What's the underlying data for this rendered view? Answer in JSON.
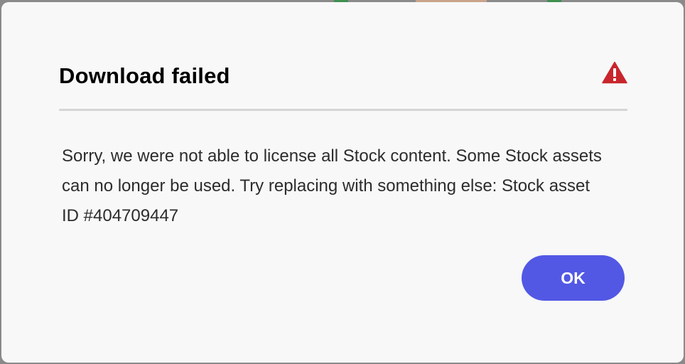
{
  "dialog": {
    "title": "Download failed",
    "message": "Sorry, we were not able to license all Stock content. Some Stock assets can no longer be used. Try replacing with something else: Stock asset ID #404709447",
    "ok_label": "OK",
    "icon": "warning-triangle-icon"
  },
  "colors": {
    "accent": "#5258e4",
    "warning": "#c9252c",
    "dialog_bg": "#f8f8f8",
    "divider": "#d5d5d5"
  }
}
